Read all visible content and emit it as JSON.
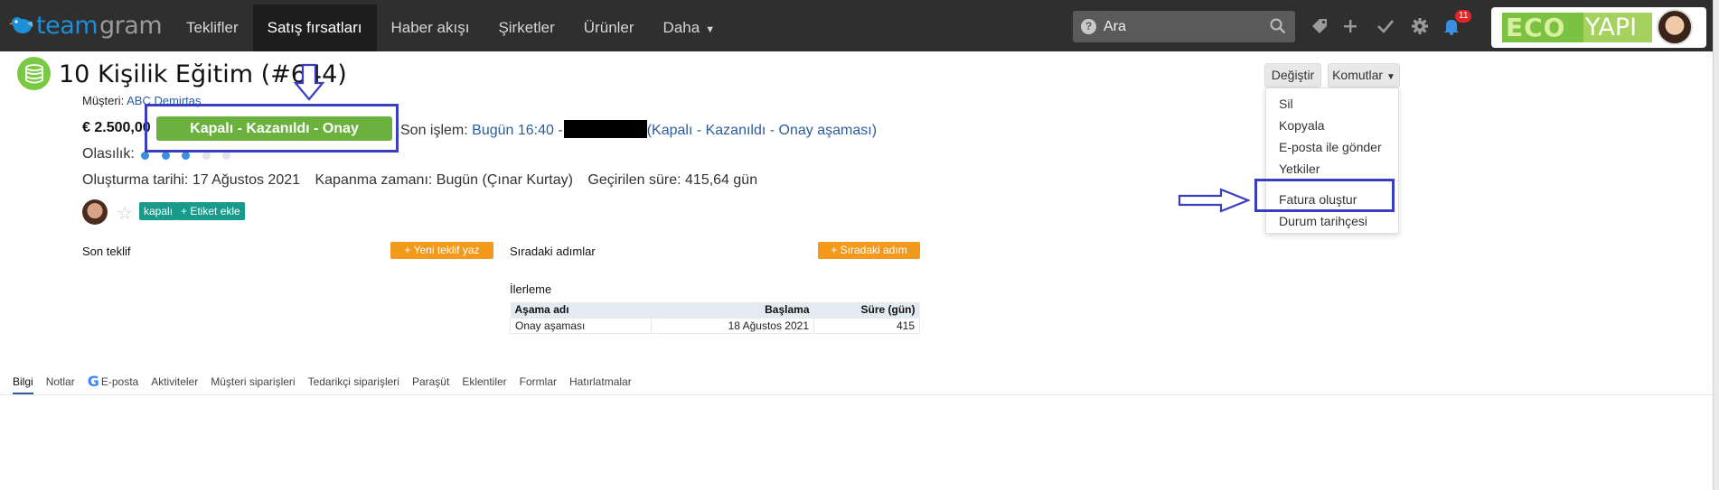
{
  "app": {
    "logo_part1": "team",
    "logo_part2": "gram"
  },
  "nav": {
    "items": [
      {
        "label": "Teklifler",
        "active": false
      },
      {
        "label": "Satış fırsatları",
        "active": true
      },
      {
        "label": "Haber akışı",
        "active": false
      },
      {
        "label": "Şirketler",
        "active": false
      },
      {
        "label": "Ürünler",
        "active": false
      },
      {
        "label": "Daha",
        "active": false
      }
    ]
  },
  "search": {
    "placeholder": "Ara",
    "help_glyph": "?"
  },
  "notifications": {
    "count": "11"
  },
  "brand": {
    "part1": "ECO",
    "part2": "YAPI"
  },
  "deal": {
    "title": "10 Kişilik Eğitim (#644)",
    "customer_label": "Müşteri:",
    "customer_name": "ABC Demirtaş",
    "amount": "€ 2.500,00",
    "stage": "Kapalı - Kazanıldı - Onay aşaması",
    "last_op_label": "Son işlem:",
    "last_op_time": "Bugün 16:40 -",
    "last_op_stage": "(Kapalı - Kazanıldı - Onay aşaması)",
    "probability_label": "Olasılık:",
    "probability": {
      "filled": 3,
      "total": 5
    },
    "created": "Oluşturma tarihi: 17 Ağustos 2021",
    "closed": "Kapanma zamanı: Bugün (Çınar Kurtay)",
    "elapsed": "Geçirilen süre: 415,64 gün",
    "tags": [
      "kapalı",
      "+ Etiket ekle"
    ]
  },
  "sections": {
    "last_offer": {
      "label": "Son teklif",
      "button": "+ Yeni teklif yaz"
    },
    "next_steps": {
      "label": "Sıradaki adımlar",
      "button": "+ Sıradaki adım"
    },
    "progress": {
      "label": "İlerleme",
      "headers": [
        "Aşama adı",
        "Başlama",
        "Süre (gün)"
      ],
      "rows": [
        [
          "Onay aşaması",
          "18 Ağustos 2021",
          "415"
        ]
      ]
    }
  },
  "actions": {
    "edit": "Değiştir",
    "commands": "Komutlar",
    "menu": [
      "Sil",
      "Kopyala",
      "E-posta ile gönder",
      "Yetkiler",
      "Fatura oluştur",
      "Durum tarihçesi"
    ]
  },
  "tabs": [
    "Bilgi",
    "Notlar",
    "E-posta",
    "Aktiviteler",
    "Müşteri siparişleri",
    "Tedarikçi siparişleri",
    "Paraşüt",
    "Eklentiler",
    "Formlar",
    "Hatırlatmalar"
  ],
  "colors": {
    "topbar": "#2f2f2f",
    "stage_green": "#6ab23d",
    "orange": "#f39a1c",
    "tag_teal": "#1a9a8b",
    "link_blue": "#2b5d9e",
    "annotation_blue": "#3b3dbf"
  }
}
